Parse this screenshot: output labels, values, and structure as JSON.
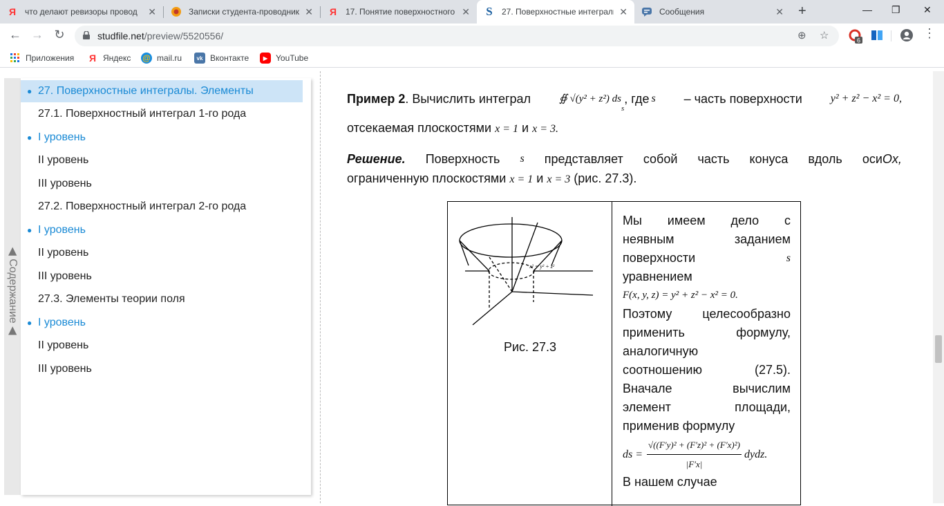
{
  "browser": {
    "tabs": [
      {
        "title": "что делают ревизоры провод",
        "favicon": "yandex-icon"
      },
      {
        "title": "Записки студента-проводник",
        "favicon": "blog-icon"
      },
      {
        "title": "17. Понятие поверхностного",
        "favicon": "yandex-icon"
      },
      {
        "title": "27. Поверхностные интеграль",
        "favicon": "studfile-icon"
      },
      {
        "title": "Сообщения",
        "favicon": "messages-icon"
      }
    ],
    "url_host": "studfile.net",
    "url_path": "/preview/5520556/",
    "extension_badge": "6",
    "bookmarks": [
      {
        "label": "Приложения",
        "icon": "apps-grid-icon"
      },
      {
        "label": "Яндекс",
        "icon": "yandex-icon"
      },
      {
        "label": "mail.ru",
        "icon": "mailru-icon"
      },
      {
        "label": "Вконтакте",
        "icon": "vk-icon"
      },
      {
        "label": "YouTube",
        "icon": "youtube-icon"
      }
    ]
  },
  "toc": {
    "tab_label": "◀ Содержание ◀",
    "items": [
      {
        "label": "27. Поверхностные интегралы. Элементы",
        "type": "selected"
      },
      {
        "label": "27.1. Поверхностный интеграл 1-го рода",
        "type": "plain"
      },
      {
        "label": "I уровень",
        "type": "bullet"
      },
      {
        "label": "II уровень",
        "type": "plain"
      },
      {
        "label": "III уровень",
        "type": "plain"
      },
      {
        "label": "27.2. Поверхностный интеграл 2-го рода",
        "type": "plain"
      },
      {
        "label": "I уровень",
        "type": "bullet"
      },
      {
        "label": "II уровень",
        "type": "plain"
      },
      {
        "label": "III уровень",
        "type": "plain"
      },
      {
        "label": "27.3. Элементы теории поля",
        "type": "plain"
      },
      {
        "label": "I уровень",
        "type": "bullet"
      },
      {
        "label": "II уровень",
        "type": "plain"
      },
      {
        "label": "III уровень",
        "type": "plain"
      }
    ]
  },
  "content": {
    "example_bold": "Пример 2",
    "example_text": ". Вычислить интеграл",
    "integral_expr": "∯ √(y² + z²) ds",
    "integral_sub": "s",
    "where_text": ", где",
    "where_var": "s",
    "part_text": "– часть поверхности",
    "surface_eq": "y² + z² − x² = 0,",
    "cut_text": "отсекаемая плоскостями",
    "x1": "x = 1",
    "and_text": "и",
    "x3": "x = 3.",
    "solution_label": "Решение.",
    "solution_word1": "Поверхность",
    "solution_var": "s",
    "solution_rest": [
      "представляет",
      "собой",
      "часть",
      "конуса",
      "вдоль",
      "оси",
      "Ox,"
    ],
    "bounded_text": "ограниченную плоскостями",
    "bx1": "x = 1",
    "band": "и",
    "bx3": "x = 3",
    "fig_ref": "(рис. 27.3).",
    "figure_caption": "Рис. 27.3",
    "fig_surface_label": "x² = y² + z²",
    "cell_lines": [
      [
        "Мы",
        "имеем",
        "дело",
        "с"
      ],
      [
        "неявным",
        "заданием"
      ],
      [
        "поверхности",
        "s"
      ],
      [
        "уравнением"
      ]
    ],
    "cell_eq1": "F(x, y, z) = y² + z² − x² = 0.",
    "cell_lines2": [
      [
        "Поэтому",
        "целесообразно"
      ],
      [
        "применить",
        "формулу,"
      ],
      [
        "аналогичную"
      ],
      [
        "соотношению",
        "(27.5)."
      ],
      [
        "Вначале",
        "вычислим"
      ],
      [
        "элемент",
        "площади,"
      ],
      [
        "применив формулу"
      ]
    ],
    "ds_formula_left": "ds =",
    "ds_formula_num": "√((F′y)² + (F′z)² + (F′x)²)",
    "ds_formula_den": "|F′x|",
    "ds_formula_right": "dydz.",
    "cell_last": "В нашем случае"
  }
}
